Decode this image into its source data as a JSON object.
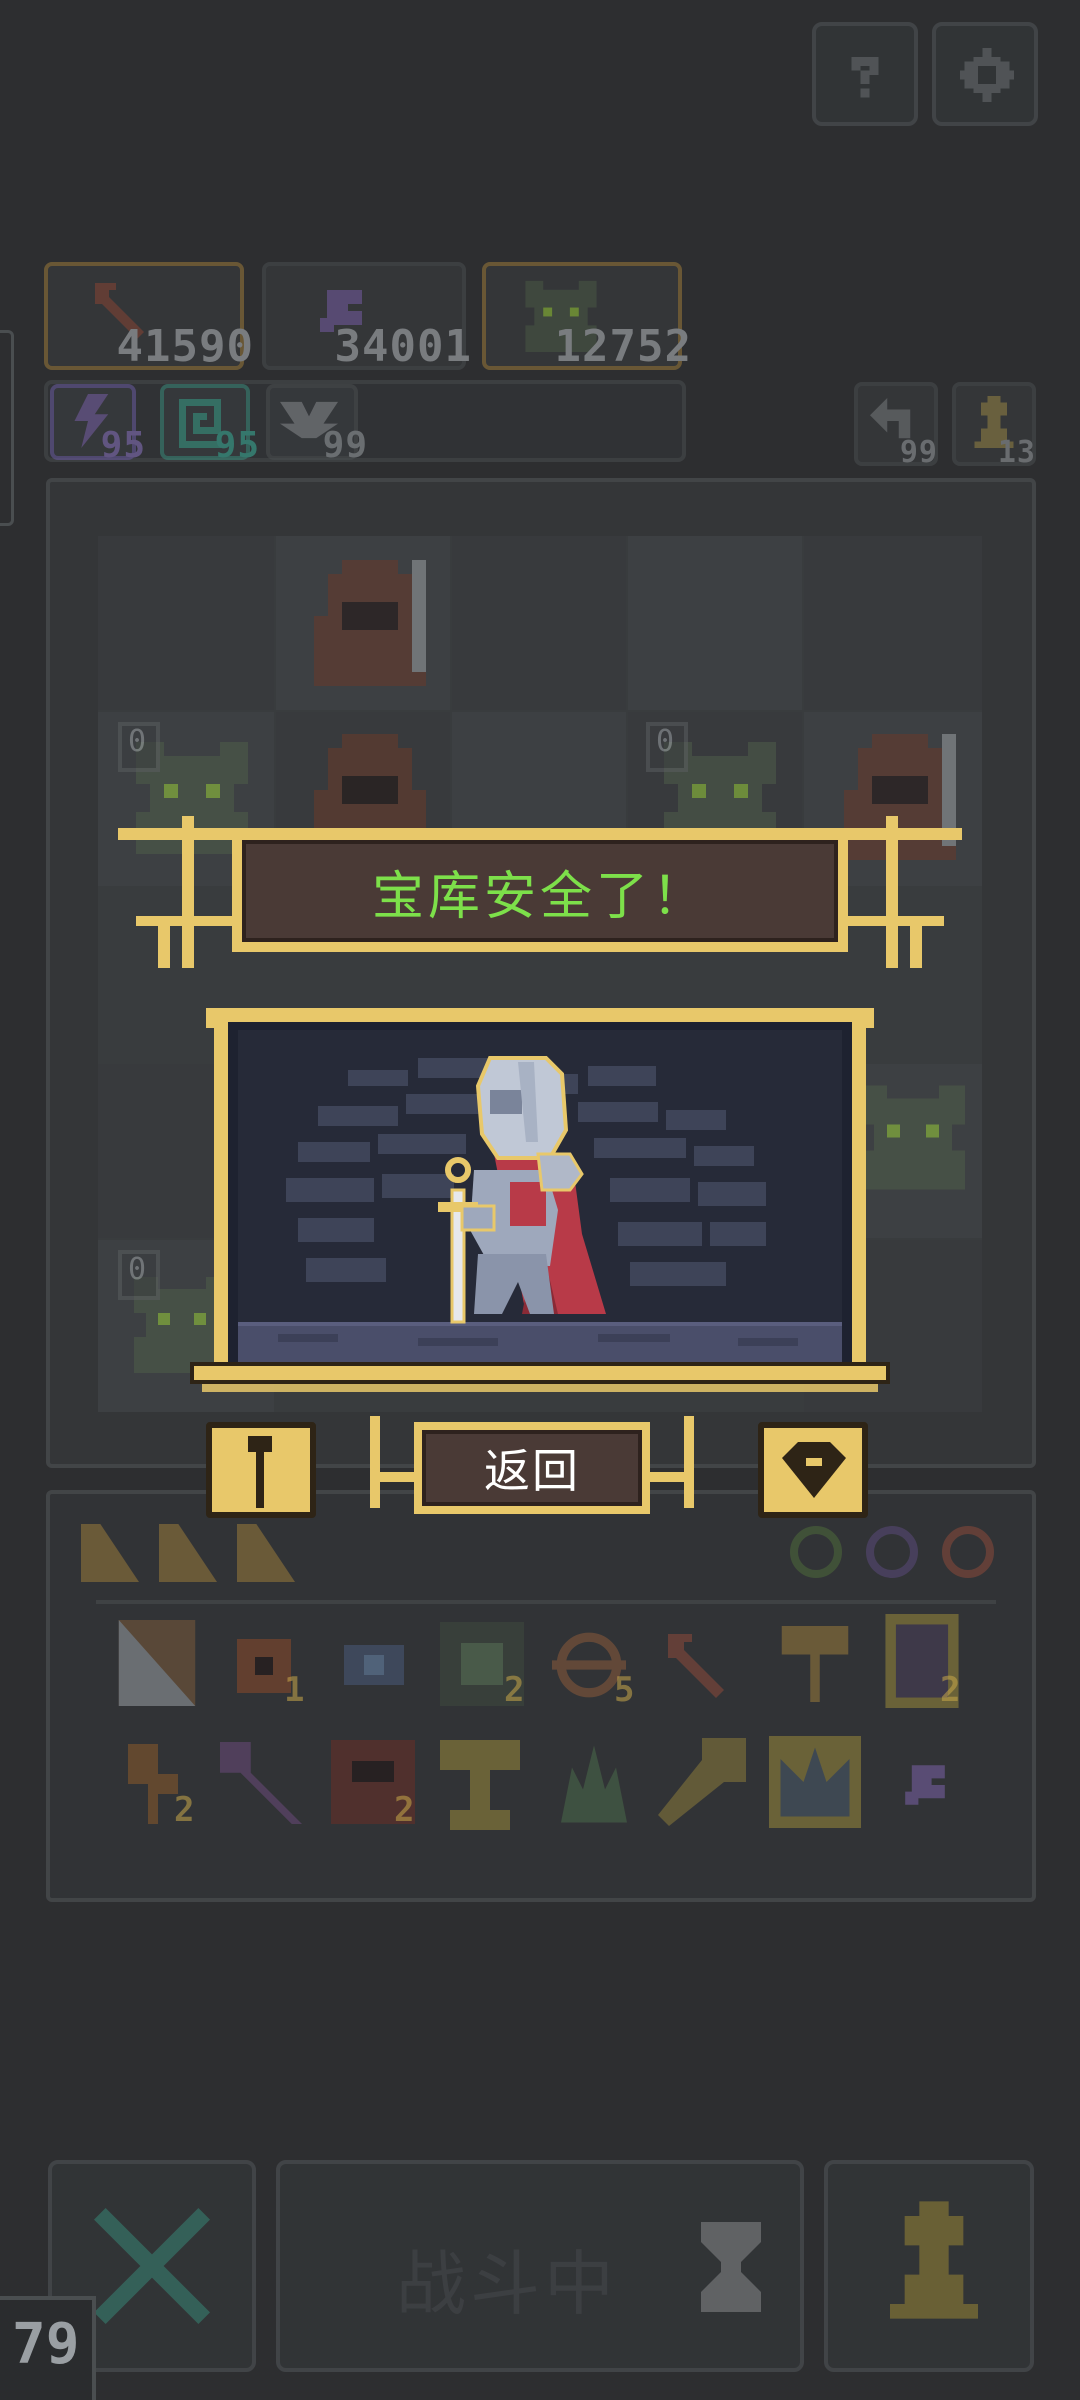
{
  "top_buttons": {
    "help_icon": "question-icon",
    "settings_icon": "gear-icon"
  },
  "resources": [
    {
      "icon": "arrow-icon",
      "value": "41590"
    },
    {
      "icon": "feather-icon",
      "value": "34001"
    },
    {
      "icon": "goblin-icon",
      "value": "12752"
    }
  ],
  "buffs": [
    {
      "icon": "lightning-icon",
      "value": "95"
    },
    {
      "icon": "spiral-icon",
      "value": "95"
    },
    {
      "icon": "wings-icon",
      "value": "99"
    }
  ],
  "counters": [
    {
      "icon": "undo-icon",
      "value": "99"
    },
    {
      "icon": "pawn-icon",
      "value": "13"
    }
  ],
  "grid_badges": [
    "0",
    "0",
    "0"
  ],
  "dialog": {
    "title": "宝库安全了！",
    "back_label": "返回",
    "colors": {
      "title_text": "#7de04a",
      "gold": "#e8c86a",
      "panel": "#4a3a36",
      "scene": "#262a38"
    }
  },
  "inventory": {
    "row1": [
      {
        "icon": "banner-icon",
        "count": ""
      },
      {
        "icon": "eye-icon",
        "count": "1"
      },
      {
        "icon": "slime-icon",
        "count": ""
      },
      {
        "icon": "goblin-card-icon",
        "count": "2"
      },
      {
        "icon": "orbit-icon",
        "count": "5"
      },
      {
        "icon": "arrow-icon",
        "count": ""
      },
      {
        "icon": "key-icon",
        "count": ""
      },
      {
        "icon": "scroll-icon",
        "count": "2"
      }
    ],
    "row2": [
      {
        "icon": "axe-icon",
        "count": "2"
      },
      {
        "icon": "spear-icon",
        "count": ""
      },
      {
        "icon": "hood-card-icon",
        "count": "2"
      },
      {
        "icon": "chalice-icon",
        "count": ""
      },
      {
        "icon": "crystal-icon",
        "count": ""
      },
      {
        "icon": "staff-icon",
        "count": ""
      },
      {
        "icon": "crown-icon",
        "count": ""
      },
      {
        "icon": "feather-icon",
        "count": ""
      }
    ]
  },
  "bottom": {
    "status_label": "战斗中",
    "level": "79",
    "cancel_icon": "x-icon",
    "hourglass_icon": "hourglass-icon",
    "pawn_icon": "pawn-icon"
  }
}
